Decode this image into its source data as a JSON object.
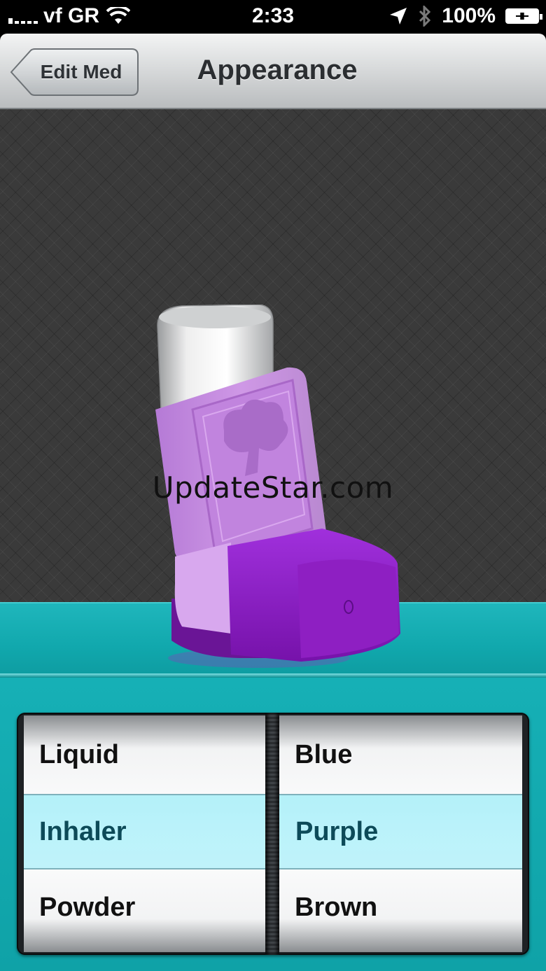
{
  "status_bar": {
    "carrier": "vf GR",
    "time": "2:33",
    "battery": "100%",
    "icons": [
      "signal-bars-icon",
      "wifi-icon",
      "location-arrow-icon",
      "bluetooth-icon",
      "battery-charging-icon"
    ]
  },
  "nav": {
    "back_label": "Edit Med",
    "title": "Appearance"
  },
  "preview": {
    "image": "purple-inhaler-illustration",
    "watermark": "UpdateStar.com"
  },
  "picker": {
    "type_column": [
      "Liquid",
      "Inhaler",
      "Powder"
    ],
    "color_column": [
      "Blue",
      "Purple",
      "Brown"
    ],
    "selected_type": "Inhaler",
    "selected_color": "Purple"
  },
  "colors": {
    "accent_teal": "#11a8ad",
    "inhaler_purple": "#8e1fc2",
    "inhaler_lilac": "#c58fe0",
    "selected_text": "#0d4a58"
  }
}
